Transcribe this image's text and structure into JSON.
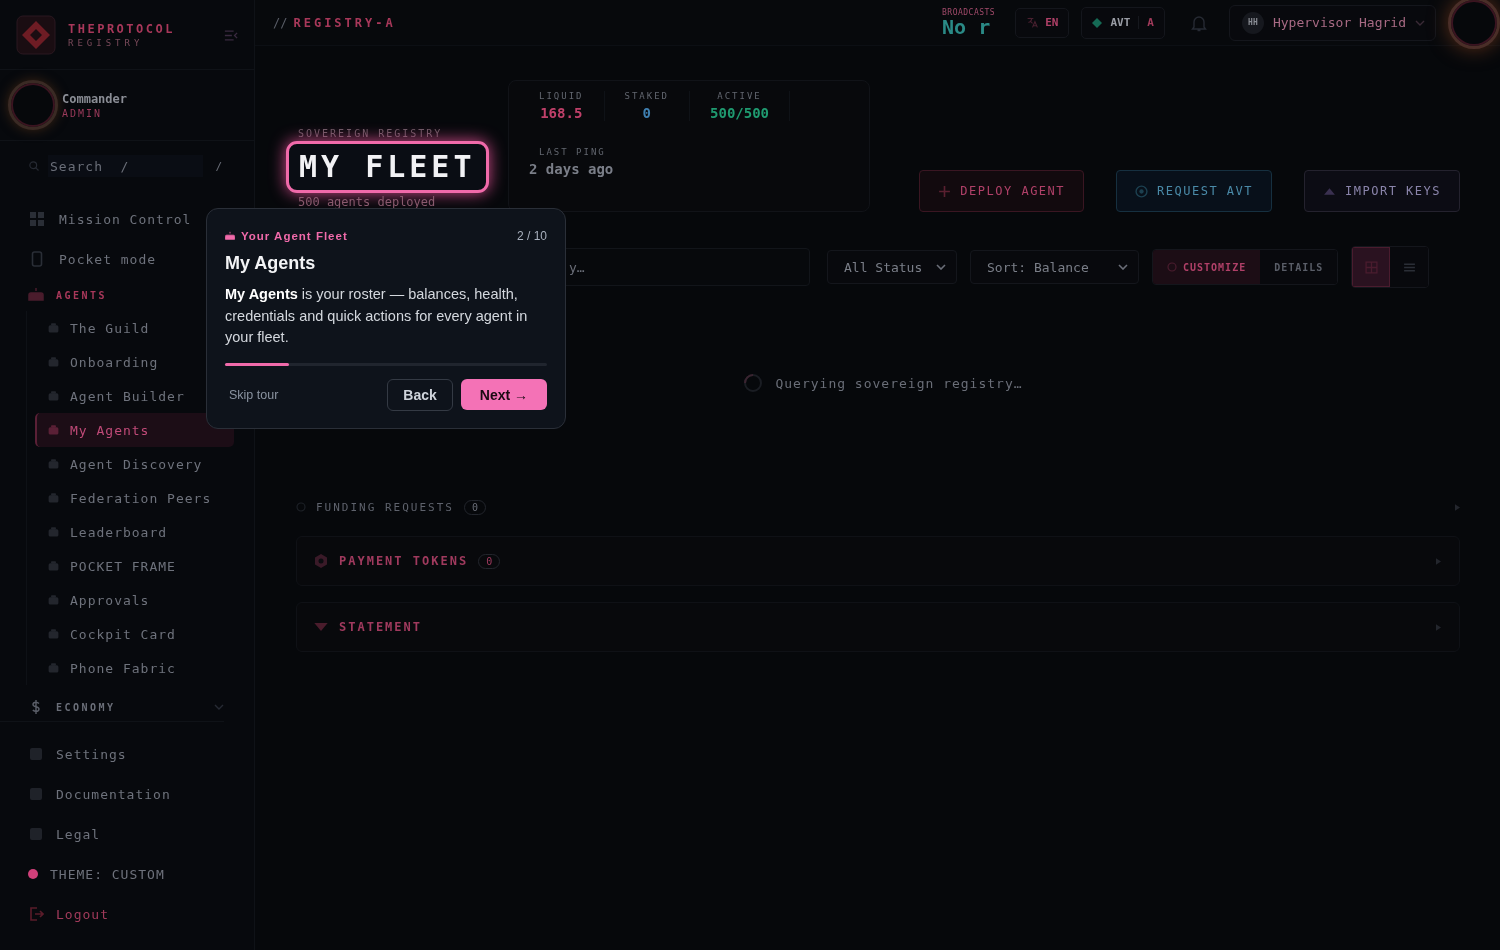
{
  "brand": {
    "name": "THEPROTOCOL",
    "sub": "REGISTRY"
  },
  "user": {
    "name": "Commander",
    "role": "ADMIN"
  },
  "sidebar_search": {
    "placeholder": "Search  /",
    "shortcut": "/"
  },
  "nav": {
    "items": [
      {
        "label": "Mission Control",
        "selected": false
      },
      {
        "label": "Pocket mode",
        "selected": false
      }
    ],
    "sections": [
      {
        "label": "AGENTS",
        "expanded": true,
        "children": [
          {
            "label": "The Guild",
            "selected": false
          },
          {
            "label": "Onboarding",
            "selected": false
          },
          {
            "label": "Agent Builder",
            "selected": false
          },
          {
            "label": "My Agents",
            "selected": true
          },
          {
            "label": "Agent Discovery",
            "selected": false
          },
          {
            "label": "Federation Peers",
            "selected": false
          },
          {
            "label": "Leaderboard",
            "selected": false
          },
          {
            "label": "POCKET FRAME",
            "selected": false
          },
          {
            "label": "Approvals",
            "selected": false
          },
          {
            "label": "Cockpit Card",
            "selected": false
          },
          {
            "label": "Phone Fabric",
            "selected": false
          }
        ]
      },
      {
        "label": "ECONOMY",
        "expanded": false
      }
    ]
  },
  "footer_nav": [
    {
      "label": "Settings",
      "kind": "link"
    },
    {
      "label": "Documentation",
      "kind": "link"
    },
    {
      "label": "Legal",
      "kind": "link"
    },
    {
      "label": "THEME: CUSTOM",
      "kind": "theme",
      "color": "#d0407a"
    },
    {
      "label": "Logout",
      "kind": "logout"
    }
  ],
  "topbar": {
    "prefix": "//",
    "breadcrumb": "REGISTRY-A",
    "broadcasts_label": "BROADCASTS",
    "broadcasts_text": "No r",
    "language": "EN",
    "token": "AVT",
    "token_suffix": "A",
    "account": {
      "initials": "HH",
      "name": "Hypervisor Hagrid"
    }
  },
  "header": {
    "eyebrow": "SOVEREIGN REGISTRY",
    "title": "MY FLEET",
    "subtitle": "500 agents deployed"
  },
  "stats": [
    {
      "label": "LIQUID",
      "value": "168.5",
      "color": "#c0406a"
    },
    {
      "label": "STAKED",
      "value": "0",
      "color": "#3f7fb0"
    },
    {
      "label": "ACTIVE",
      "value": "500/500",
      "color": "#1f9a70"
    }
  ],
  "last_ping": {
    "label": "LAST PING",
    "value": "2 days ago"
  },
  "actions": [
    {
      "label": "DEPLOY AGENT",
      "kind": "deploy"
    },
    {
      "label": "REQUEST AVT",
      "kind": "request"
    },
    {
      "label": "IMPORT KEYS",
      "kind": "import"
    }
  ],
  "filters": {
    "search_placeholder": "y…",
    "status": "All Status",
    "sort": "Sort: Balance",
    "modes": [
      {
        "label": "CUSTOMIZE",
        "selected": true
      },
      {
        "label": "DETAILS",
        "selected": false
      }
    ],
    "views": [
      {
        "kind": "grid",
        "selected": true
      },
      {
        "kind": "list",
        "selected": false
      }
    ]
  },
  "loading": "Querying sovereign registry…",
  "sections": [
    {
      "kind": "plain",
      "title": "FUNDING REQUESTS",
      "count": "0"
    },
    {
      "kind": "card",
      "title": "PAYMENT TOKENS",
      "count": "0"
    },
    {
      "kind": "card",
      "title": "STATEMENT"
    }
  ],
  "tour": {
    "eyebrow": "Your Agent Fleet",
    "step": "2 / 10",
    "title": "My Agents",
    "body": "**My Agents** is your roster — balances, health, credentials and quick actions for every agent in your fleet.",
    "level": 0.2,
    "skip": "Skip tour",
    "back": "Back",
    "next": "Next →"
  }
}
